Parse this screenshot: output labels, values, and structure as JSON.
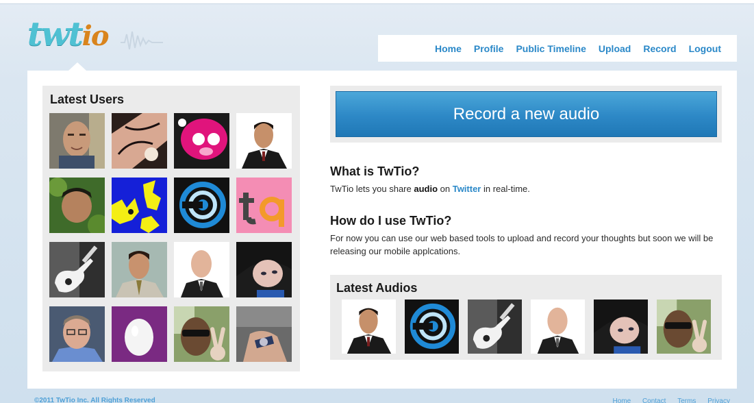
{
  "logo": {
    "part1": "twt",
    "part2": "io"
  },
  "nav": [
    {
      "label": "Home"
    },
    {
      "label": "Profile"
    },
    {
      "label": "Public Timeline"
    },
    {
      "label": "Upload"
    },
    {
      "label": "Record"
    },
    {
      "label": "Logout"
    }
  ],
  "latest_users": {
    "title": "Latest Users",
    "users": [
      {
        "avatar": "man-smiling-photo"
      },
      {
        "avatar": "sleeping-faces-drawing"
      },
      {
        "avatar": "pink-pig-illustration"
      },
      {
        "avatar": "man-in-suit-photo"
      },
      {
        "avatar": "man-in-foliage-photo"
      },
      {
        "avatar": "yellow-blue-map"
      },
      {
        "avatar": "blue-swirl-logo"
      },
      {
        "avatar": "tq-logo"
      },
      {
        "avatar": "white-guitar-photo"
      },
      {
        "avatar": "man-in-tie-photo"
      },
      {
        "avatar": "bald-man-suit-photo"
      },
      {
        "avatar": "dark-haired-girl-photo"
      },
      {
        "avatar": "man-glasses-photo"
      },
      {
        "avatar": "default-egg-avatar"
      },
      {
        "avatar": "man-sunglasses-peace-photo"
      },
      {
        "avatar": "hand-wristwatch-photo"
      }
    ]
  },
  "record": {
    "label": "Record a new audio"
  },
  "what": {
    "heading": "What is TwTio?",
    "text_before": "TwTio lets you share ",
    "text_bold": "audio",
    "text_mid": " on ",
    "link": "Twitter",
    "text_after": " in real-time."
  },
  "how": {
    "heading": "How do I use TwTio?",
    "text": "For now you can use our web based tools to upload and record your thoughts but soon we will be releasing our mobile applcations."
  },
  "latest_audios": {
    "title": "Latest Audios",
    "audios": [
      {
        "avatar": "man-in-suit-photo"
      },
      {
        "avatar": "blue-swirl-logo"
      },
      {
        "avatar": "white-guitar-photo"
      },
      {
        "avatar": "bald-man-suit-photo"
      },
      {
        "avatar": "dark-haired-girl-photo"
      },
      {
        "avatar": "man-sunglasses-peace-photo"
      }
    ]
  },
  "footer": {
    "copyright": "©2011 TwTio Inc. All Rights Reserved",
    "links": [
      {
        "label": "Home"
      },
      {
        "label": "Contact"
      },
      {
        "label": "Terms"
      },
      {
        "label": "Privacy"
      }
    ]
  },
  "colors": {
    "accent": "#2a88c8",
    "button": "#2d88c6",
    "logo_teal": "#4fc1d3",
    "logo_orange": "#d9841d",
    "panel_gray": "#ebebeb"
  }
}
